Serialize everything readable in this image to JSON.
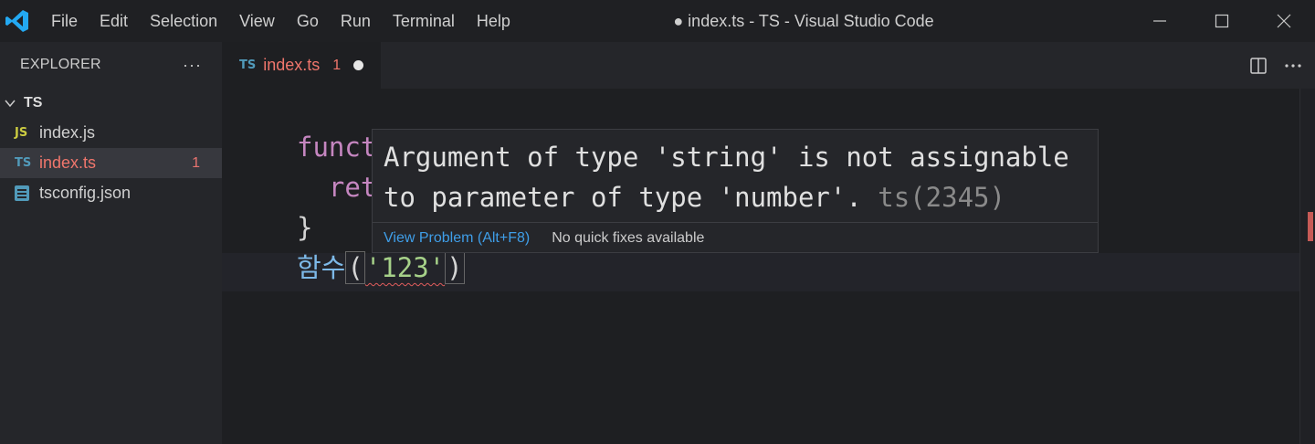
{
  "window": {
    "title": "● index.ts - TS - Visual Studio Code",
    "menu": [
      "File",
      "Edit",
      "Selection",
      "View",
      "Go",
      "Run",
      "Terminal",
      "Help"
    ]
  },
  "sidebar": {
    "title": "EXPLORER",
    "more": "···",
    "folder": "TS",
    "files": [
      {
        "icon": "JS",
        "name": "index.js",
        "badge": ""
      },
      {
        "icon": "TS",
        "name": "index.ts",
        "badge": "1"
      },
      {
        "icon": "tsconfig-icon",
        "name": "tsconfig.json",
        "badge": ""
      }
    ]
  },
  "tab": {
    "icon": "TS",
    "label": "index.ts",
    "badge": "1"
  },
  "code": {
    "line1_kw": "funct",
    "line2": "  ret",
    "line3": "}",
    "line4_fn": "함수",
    "line4_open": "(",
    "line4_str": "'123'",
    "line4_close": ")"
  },
  "hover": {
    "message_line1": "Argument of type 'string' is not assignable",
    "message_line2": "to parameter of type 'number'.",
    "code": "ts(2345)",
    "view_problem": "View Problem (Alt+F8)",
    "no_fixes": "No quick fixes available"
  },
  "colors": {
    "error": "#f0766c",
    "keyword": "#c586c0",
    "string": "#a6d189",
    "link": "#3f9ee8"
  }
}
